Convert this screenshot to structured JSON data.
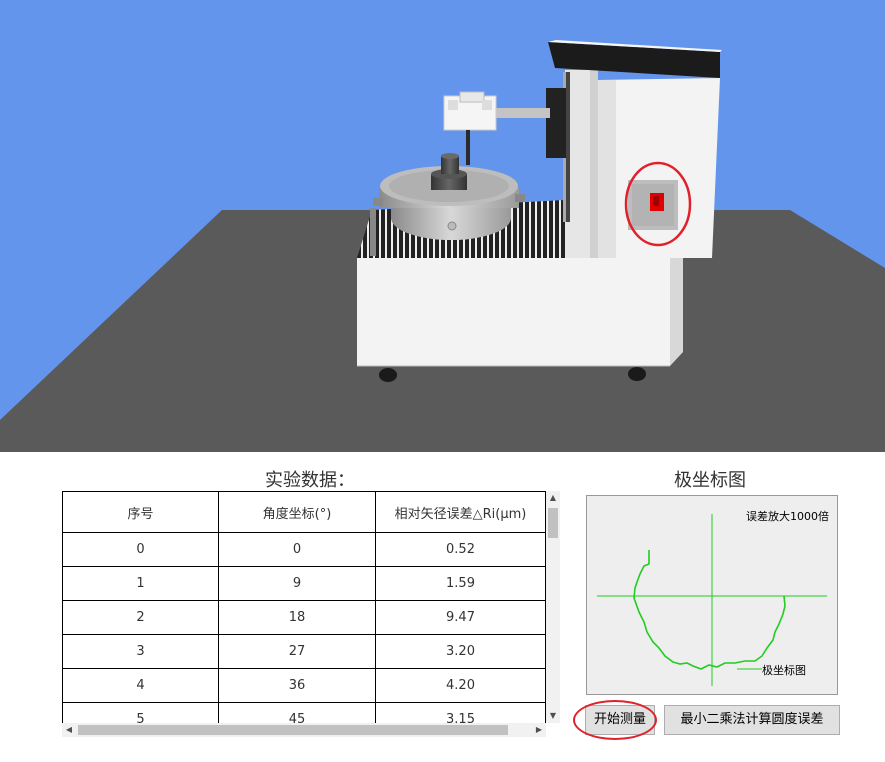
{
  "scene": {
    "sky_color": "#6495ed",
    "floor_color": "#5a5a5a",
    "machine_color": "#f2f2f2",
    "switch_color": "#e00000",
    "highlight_color": "#e0202a"
  },
  "table": {
    "title": "实验数据：",
    "headers": [
      "序号",
      "角度坐标(°)",
      "相对矢径误差△Ri(μm)"
    ],
    "rows": [
      [
        "0",
        "0",
        "0.52"
      ],
      [
        "1",
        "9",
        "1.59"
      ],
      [
        "2",
        "18",
        "9.47"
      ],
      [
        "3",
        "27",
        "3.20"
      ],
      [
        "4",
        "36",
        "4.20"
      ],
      [
        "5",
        "45",
        "3.15"
      ]
    ]
  },
  "polar": {
    "title": "极坐标图",
    "note": "误差放大1000倍",
    "legend": "极坐标图",
    "curve_color": "#22cc22"
  },
  "buttons": {
    "start": "开始测量",
    "least_squares": "最小二乘法计算圆度误差"
  }
}
